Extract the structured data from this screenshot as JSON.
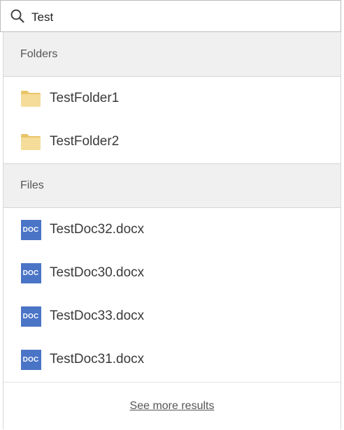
{
  "search": {
    "value": "Test",
    "icon": "search-icon"
  },
  "folders": {
    "header": "Folders",
    "icon": "folder-icon",
    "items": [
      {
        "label": "TestFolder1"
      },
      {
        "label": "TestFolder2"
      }
    ]
  },
  "files": {
    "header": "Files",
    "icon": "doc-icon",
    "icon_text": "DOC",
    "items": [
      {
        "label": "TestDoc32.docx"
      },
      {
        "label": "TestDoc30.docx"
      },
      {
        "label": "TestDoc33.docx"
      },
      {
        "label": "TestDoc31.docx"
      }
    ]
  },
  "footer": {
    "see_more": "See more results"
  },
  "colors": {
    "doc_icon": "#4a74c6",
    "folder_fill": "#f3d68c",
    "header_bg": "#f0f0f0"
  }
}
